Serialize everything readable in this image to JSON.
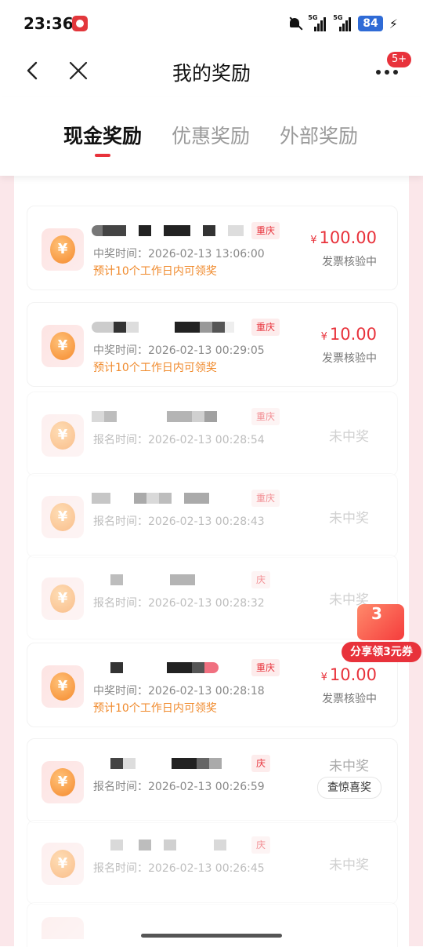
{
  "status_bar": {
    "time": "23:36",
    "signal1_label": "5G",
    "signal2_label": "5G",
    "battery": "84"
  },
  "header": {
    "title": "我的奖励",
    "notification_badge": "5+"
  },
  "tabs": [
    {
      "label": "现金奖励",
      "active": true
    },
    {
      "label": "优惠奖励",
      "active": false
    },
    {
      "label": "外部奖励",
      "active": false
    }
  ],
  "records": [
    {
      "tag": "重庆",
      "time_label": "中奖时间：",
      "time": "2026-02-13 13:06:00",
      "note": "预计10个工作日内可领奖",
      "currency": "¥",
      "amount": "100.00",
      "status": "发票核验中"
    },
    {
      "tag": "重庆",
      "time_label": "中奖时间：",
      "time": "2026-02-13 00:29:05",
      "note": "预计10个工作日内可领奖",
      "currency": "¥",
      "amount": "10.00",
      "status": "发票核验中"
    },
    {
      "tag": "重庆",
      "time_label": "报名时间：",
      "time": "2026-02-13 00:28:54",
      "status": "未中奖"
    },
    {
      "tag": "重庆",
      "time_label": "报名时间：",
      "time": "2026-02-13 00:28:43",
      "status": "未中奖"
    },
    {
      "tag": "庆",
      "time_label": "报名时间：",
      "time": "2026-02-13 00:28:32",
      "status": "未中奖"
    },
    {
      "tag": "重庆",
      "time_label": "中奖时间：",
      "time": "2026-02-13 00:28:18",
      "note": "预计10个工作日内可领奖",
      "currency": "¥",
      "amount": "10.00",
      "status": "发票核验中"
    },
    {
      "tag": "庆",
      "time_label": "报名时间：",
      "time": "2026-02-13 00:26:59",
      "status": "未中奖",
      "action": "查惊喜奖"
    },
    {
      "tag": "庆",
      "time_label": "报名时间：",
      "time": "2026-02-13 00:26:45",
      "status": "未中奖"
    }
  ],
  "promo": {
    "number": "3",
    "label": "分享领3元券"
  },
  "colors": {
    "accent": "#e8323b",
    "note": "#f08a2c",
    "coin": "#f58a2d"
  }
}
